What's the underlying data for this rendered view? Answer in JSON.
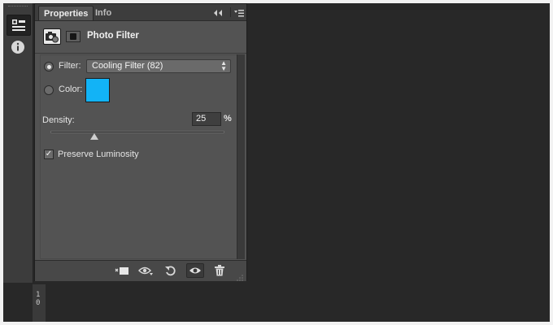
{
  "tabs": [
    {
      "label": "Properties",
      "active": true
    },
    {
      "label": "Info",
      "active": false
    }
  ],
  "header": {
    "title": "Photo Filter"
  },
  "filter": {
    "label": "Filter:",
    "selected": true,
    "value": "Cooling Filter (82)"
  },
  "color": {
    "label": "Color:",
    "selected": false,
    "swatch": "#12b3f6"
  },
  "density": {
    "label": "Density:",
    "value": "25",
    "unit": "%",
    "slider_fraction": 0.25
  },
  "preserve_luminosity": {
    "label": "Preserve Luminosity",
    "checked": true
  },
  "ruler": {
    "digits": [
      "1",
      "0"
    ]
  },
  "colors": {
    "panel": "#535353",
    "canvas": "#282828",
    "accent_swatch": "#12b3f6"
  }
}
